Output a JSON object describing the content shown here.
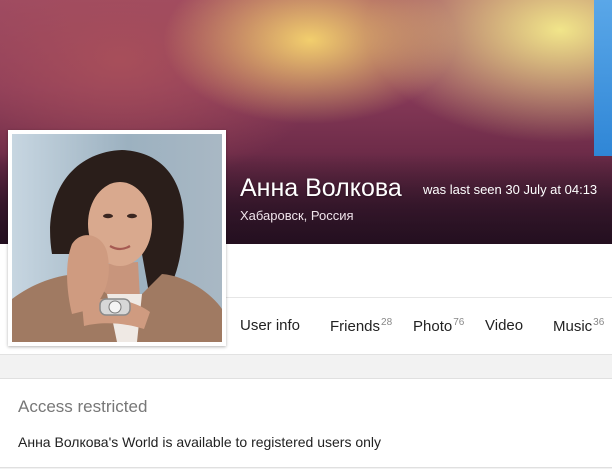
{
  "profile": {
    "name": "Анна Волкова",
    "last_seen": "was last seen 30 July at 04:13",
    "location": "Хабаровск, Россия",
    "accent_color": "#2f86d6"
  },
  "tabs": [
    {
      "label": "User info",
      "count": ""
    },
    {
      "label": "Friends",
      "count": "28"
    },
    {
      "label": "Photo",
      "count": "76"
    },
    {
      "label": "Video",
      "count": ""
    },
    {
      "label": "Music",
      "count": "36"
    }
  ],
  "access": {
    "title": "Access restricted",
    "message": "Анна Волкова's World is available to registered users only"
  }
}
